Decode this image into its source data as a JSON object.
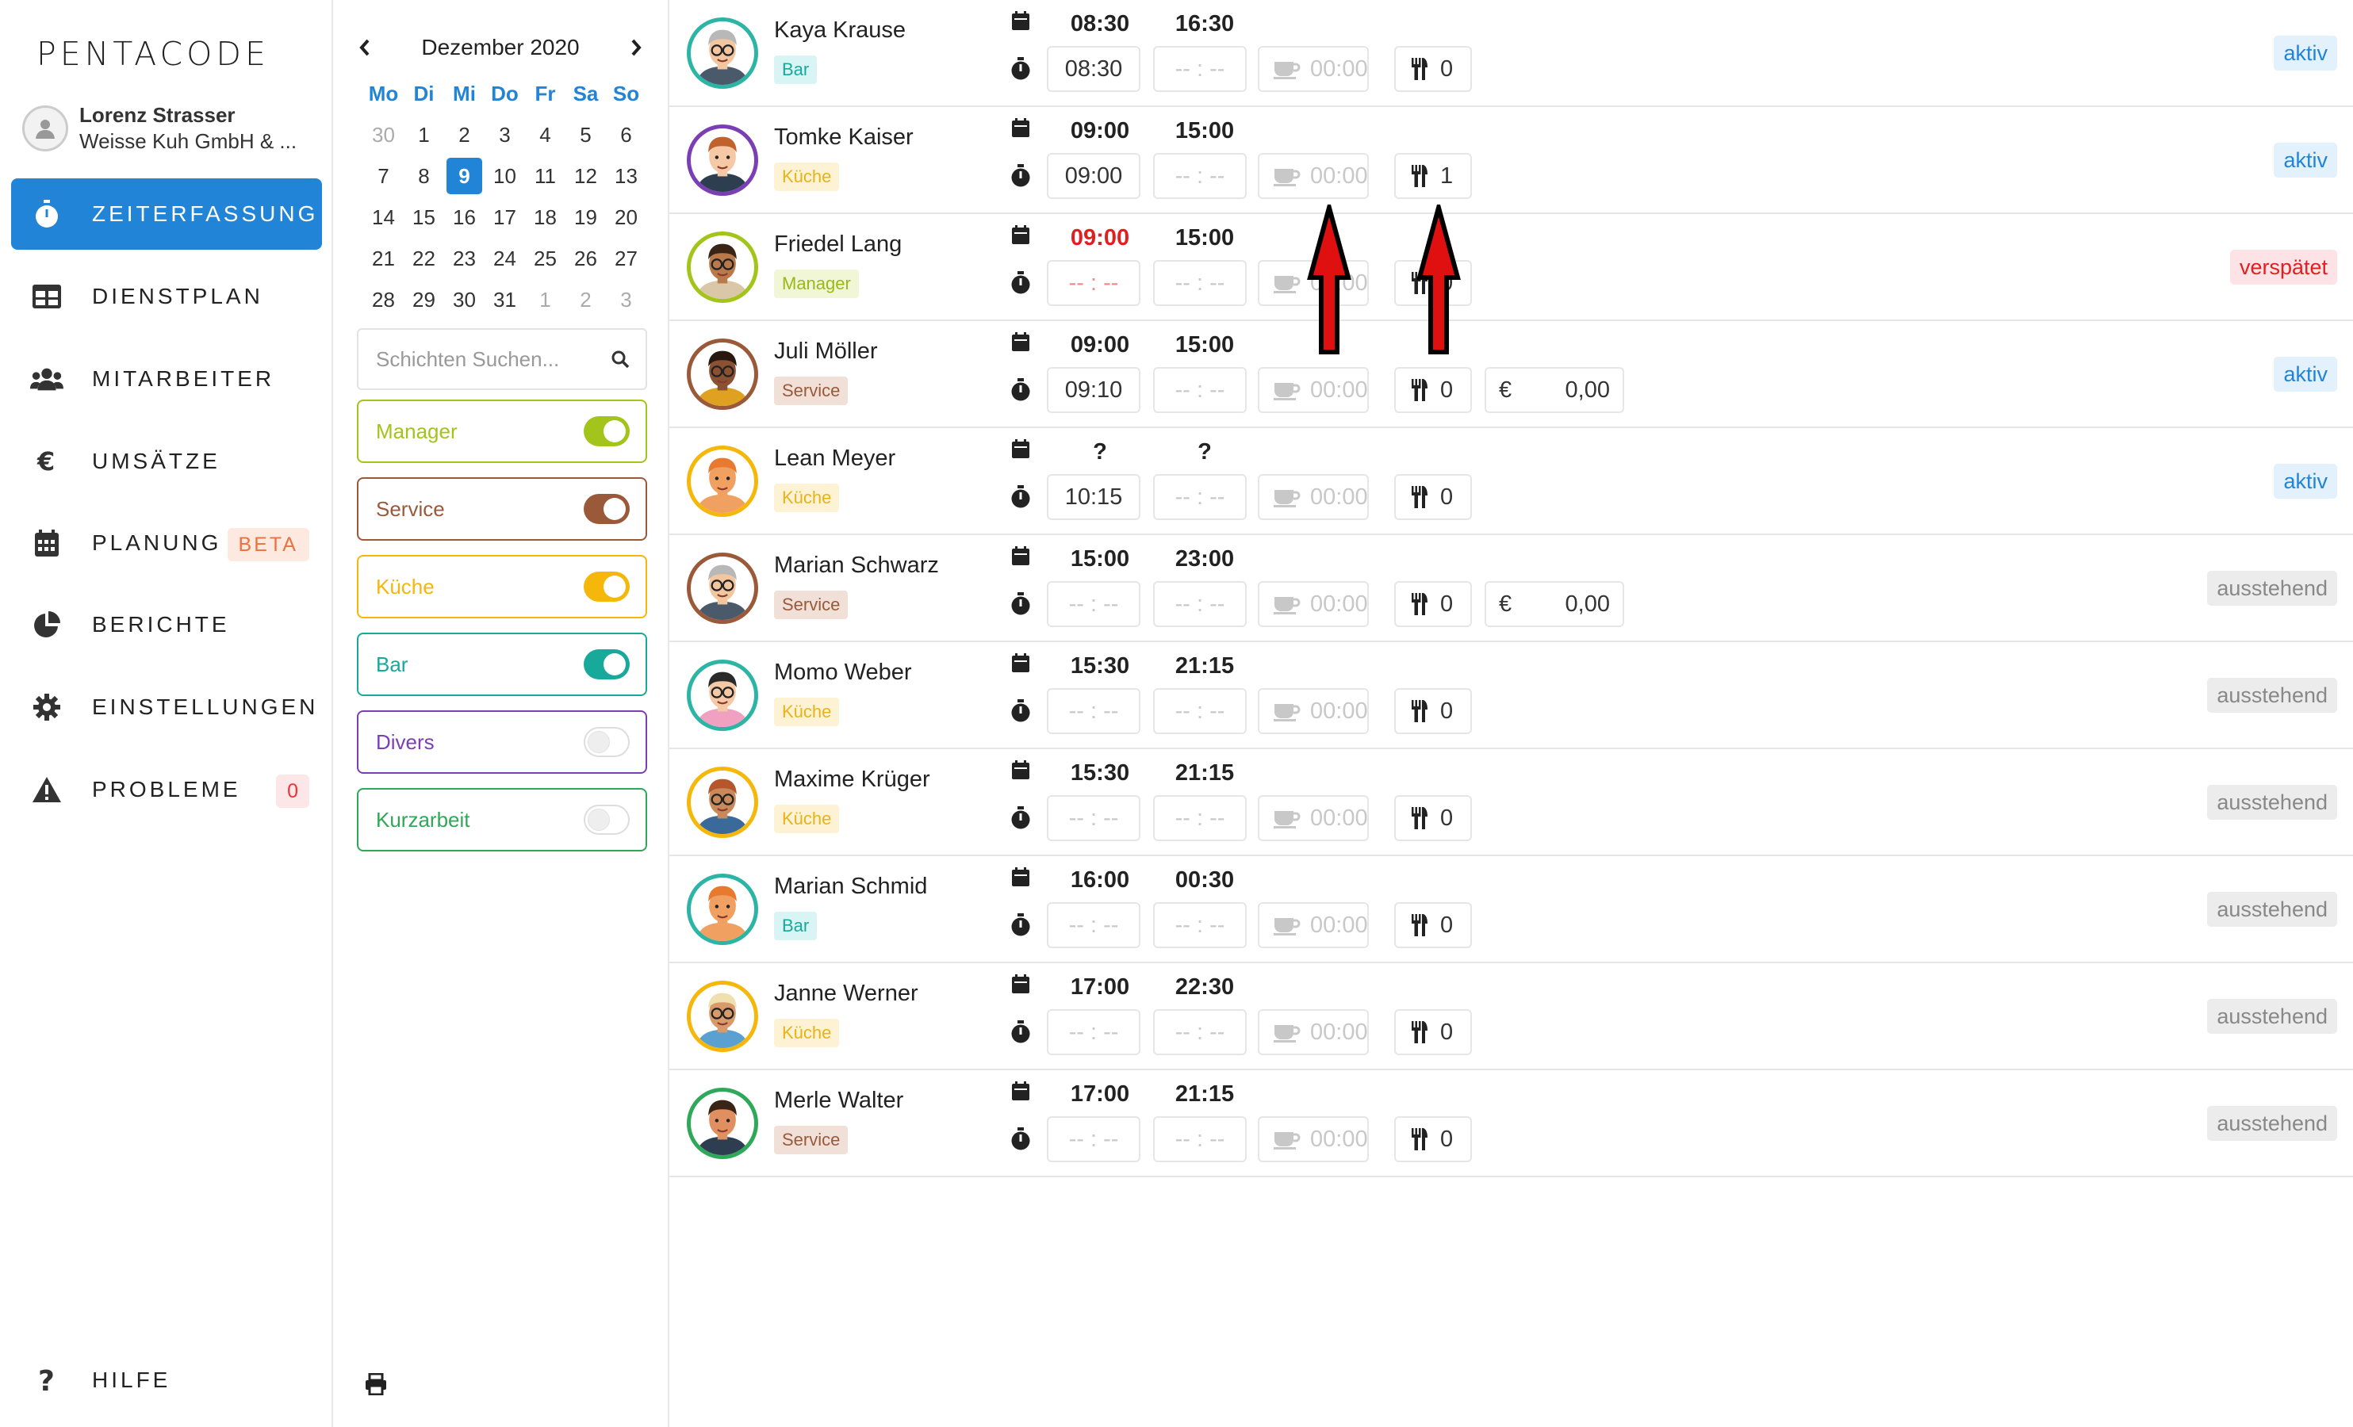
{
  "brand": {
    "logo": "PENTACODE"
  },
  "user": {
    "name": "Lorenz Strasser",
    "company": "Weisse Kuh GmbH & ..."
  },
  "nav": {
    "zeiterfassung": "ZEITERFASSUNG",
    "dienstplan": "DIENSTPLAN",
    "mitarbeiter": "MITARBEITER",
    "umsaetze": "UMSÄTZE",
    "planung": "PLANUNG",
    "planung_badge": "BETA",
    "berichte": "BERICHTE",
    "einstellungen": "EINSTELLUNGEN",
    "probleme": "PROBLEME",
    "probleme_badge": "0",
    "hilfe": "HILFE"
  },
  "calendar": {
    "month": "Dezember 2020",
    "weekdays": [
      "Mo",
      "Di",
      "Mi",
      "Do",
      "Fr",
      "Sa",
      "So"
    ],
    "days": [
      {
        "d": "30",
        "o": true
      },
      {
        "d": "1"
      },
      {
        "d": "2"
      },
      {
        "d": "3"
      },
      {
        "d": "4"
      },
      {
        "d": "5"
      },
      {
        "d": "6"
      },
      {
        "d": "7"
      },
      {
        "d": "8"
      },
      {
        "d": "9",
        "sel": true
      },
      {
        "d": "10"
      },
      {
        "d": "11"
      },
      {
        "d": "12"
      },
      {
        "d": "13"
      },
      {
        "d": "14"
      },
      {
        "d": "15"
      },
      {
        "d": "16"
      },
      {
        "d": "17"
      },
      {
        "d": "18"
      },
      {
        "d": "19"
      },
      {
        "d": "20"
      },
      {
        "d": "21"
      },
      {
        "d": "22"
      },
      {
        "d": "23"
      },
      {
        "d": "24"
      },
      {
        "d": "25"
      },
      {
        "d": "26"
      },
      {
        "d": "27"
      },
      {
        "d": "28"
      },
      {
        "d": "29"
      },
      {
        "d": "30"
      },
      {
        "d": "31"
      },
      {
        "d": "1",
        "o": true
      },
      {
        "d": "2",
        "o": true
      },
      {
        "d": "3",
        "o": true
      }
    ]
  },
  "search": {
    "placeholder": "Schichten Suchen..."
  },
  "filters": [
    {
      "label": "Manager",
      "color": "#a3c41a",
      "on": true
    },
    {
      "label": "Service",
      "color": "#9a5a3a",
      "on": true
    },
    {
      "label": "Küche",
      "color": "#f5b70a",
      "on": true
    },
    {
      "label": "Bar",
      "color": "#18a99a",
      "on": true
    },
    {
      "label": "Divers",
      "color": "#7b3fb5",
      "on": false
    },
    {
      "label": "Kurzarbeit",
      "color": "#2fa85a",
      "on": false
    }
  ],
  "tag_styles": {
    "Bar": {
      "bg": "#d9f4f4",
      "fg": "#18a99a"
    },
    "Küche": {
      "bg": "#fdf3d4",
      "fg": "#e8b31a"
    },
    "Manager": {
      "bg": "#f1f6d7",
      "fg": "#9ab81a"
    },
    "Service": {
      "bg": "#f0e0d8",
      "fg": "#9a5a3a"
    }
  },
  "status_labels": {
    "aktiv": "aktiv",
    "verspaetet": "verspätet",
    "ausstehend": "ausstehend"
  },
  "placeholder_time": "-- : --",
  "employees": [
    {
      "name": "Kaya Krause",
      "tag": "Bar",
      "plan_start": "08:30",
      "plan_end": "16:30",
      "clock_in": "08:30",
      "clock_out": "",
      "break": "00:00",
      "meals": "0",
      "revenue": null,
      "status": "aktiv",
      "ring": "#2cb5a5",
      "skin": "#f3c6a0",
      "hair": "#b8b8b8",
      "shirt": "#4a5a6a",
      "glasses": true
    },
    {
      "name": "Tomke Kaiser",
      "tag": "Küche",
      "plan_start": "09:00",
      "plan_end": "15:00",
      "clock_in": "09:00",
      "clock_out": "",
      "break": "00:00",
      "meals": "1",
      "revenue": null,
      "status": "aktiv",
      "ring": "#7b3fb5",
      "skin": "#f5c9a5",
      "hair": "#c0622c",
      "shirt": "#2c3e50",
      "glasses": false
    },
    {
      "name": "Friedel Lang",
      "tag": "Manager",
      "plan_start": "09:00",
      "plan_end": "15:00",
      "clock_in": "",
      "clock_out": "",
      "break": "00:00",
      "meals": "0",
      "revenue": null,
      "status": "verspaetet",
      "start_late": true,
      "ring": "#a3c41a",
      "skin": "#b97a4b",
      "hair": "#3a2416",
      "shirt": "#d9c7a8",
      "glasses": true
    },
    {
      "name": "Juli Möller",
      "tag": "Service",
      "plan_start": "09:00",
      "plan_end": "15:00",
      "clock_in": "09:10",
      "clock_out": "",
      "break": "00:00",
      "meals": "0",
      "revenue": "0,00",
      "status": "aktiv",
      "ring": "#9a5a3a",
      "skin": "#8a5232",
      "hair": "#2a1810",
      "shirt": "#e0a020",
      "glasses": true
    },
    {
      "name": "Lean Meyer",
      "tag": "Küche",
      "plan_start": "?",
      "plan_end": "?",
      "clock_in": "10:15",
      "clock_out": "",
      "break": "00:00",
      "meals": "0",
      "revenue": null,
      "status": "aktiv",
      "ring": "#f5b70a",
      "skin": "#f0a060",
      "hair": "#e87a30",
      "shirt": "#f0a060",
      "glasses": false
    },
    {
      "name": "Marian Schwarz",
      "tag": "Service",
      "plan_start": "15:00",
      "plan_end": "23:00",
      "clock_in": "",
      "clock_out": "",
      "break": "00:00",
      "meals": "0",
      "revenue": "0,00",
      "status": "ausstehend",
      "ring": "#9a5a3a",
      "skin": "#f3c6a0",
      "hair": "#b8b8b8",
      "shirt": "#4a5a6a",
      "glasses": true
    },
    {
      "name": "Momo Weber",
      "tag": "Küche",
      "plan_start": "15:30",
      "plan_end": "21:15",
      "clock_in": "",
      "clock_out": "",
      "break": "00:00",
      "meals": "0",
      "revenue": null,
      "status": "ausstehend",
      "ring": "#2cb5a5",
      "skin": "#f5c9a5",
      "hair": "#2a2a2a",
      "shirt": "#f0a0c0",
      "glasses": true
    },
    {
      "name": "Maxime Krüger",
      "tag": "Küche",
      "plan_start": "15:30",
      "plan_end": "21:15",
      "clock_in": "",
      "clock_out": "",
      "break": "00:00",
      "meals": "0",
      "revenue": null,
      "status": "ausstehend",
      "ring": "#f5b70a",
      "skin": "#c88a5a",
      "hair": "#b5562c",
      "shirt": "#3a6a9a",
      "glasses": true
    },
    {
      "name": "Marian Schmid",
      "tag": "Bar",
      "plan_start": "16:00",
      "plan_end": "00:30",
      "clock_in": "",
      "clock_out": "",
      "break": "00:00",
      "meals": "0",
      "revenue": null,
      "status": "ausstehend",
      "ring": "#2cb5a5",
      "skin": "#f0a060",
      "hair": "#e87a30",
      "shirt": "#f0a060",
      "glasses": false
    },
    {
      "name": "Janne Werner",
      "tag": "Küche",
      "plan_start": "17:00",
      "plan_end": "22:30",
      "clock_in": "",
      "clock_out": "",
      "break": "00:00",
      "meals": "0",
      "revenue": null,
      "status": "ausstehend",
      "ring": "#f5b70a",
      "skin": "#d89a6a",
      "hair": "#f0e0b0",
      "shirt": "#5aa0d0",
      "glasses": true
    },
    {
      "name": "Merle Walter",
      "tag": "Service",
      "plan_start": "17:00",
      "plan_end": "21:15",
      "clock_in": "",
      "clock_out": "",
      "break": "00:00",
      "meals": "0",
      "revenue": null,
      "status": "ausstehend",
      "ring": "#2fa85a",
      "skin": "#e09060",
      "hair": "#3a2416",
      "shirt": "#2c3e50",
      "glasses": false
    }
  ]
}
